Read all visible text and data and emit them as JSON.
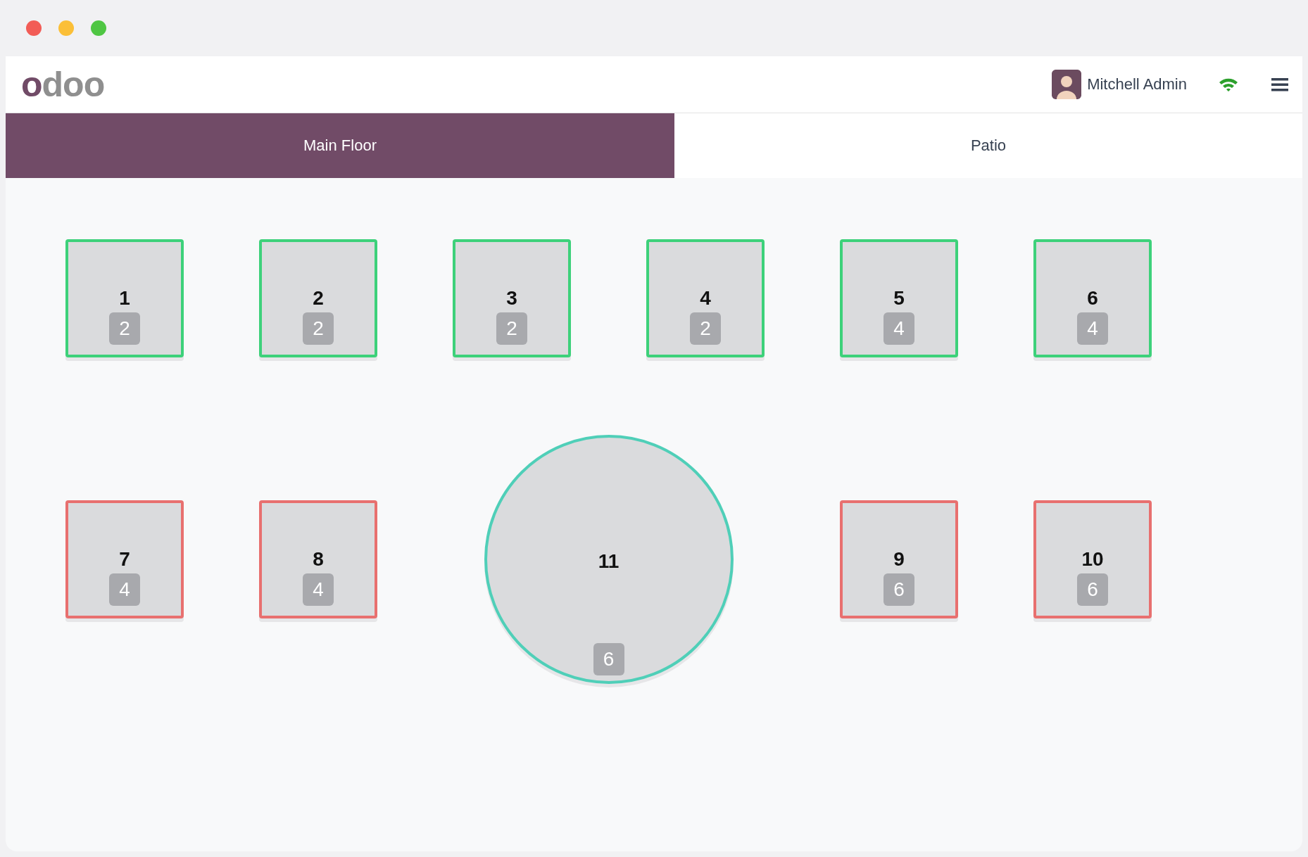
{
  "header": {
    "logo": "odoo",
    "user": "Mitchell Admin"
  },
  "tabs": [
    {
      "label": "Main Floor",
      "selected": true
    },
    {
      "label": "Patio",
      "selected": false
    }
  ],
  "tables": [
    {
      "kind": "square",
      "name": "1",
      "seats": "2",
      "color": "#3dd17a"
    },
    {
      "kind": "square",
      "name": "2",
      "seats": "2",
      "color": "#3dd17a"
    },
    {
      "kind": "square",
      "name": "3",
      "seats": "2",
      "color": "#3dd17a"
    },
    {
      "kind": "square",
      "name": "4",
      "seats": "2",
      "color": "#3dd17a"
    },
    {
      "kind": "square",
      "name": "5",
      "seats": "4",
      "color": "#3dd17a"
    },
    {
      "kind": "square",
      "name": "6",
      "seats": "4",
      "color": "#3dd17a"
    },
    {
      "kind": "square",
      "name": "7",
      "seats": "4",
      "color": "#e8706f"
    },
    {
      "kind": "square",
      "name": "8",
      "seats": "4",
      "color": "#e8706f"
    },
    {
      "kind": "round",
      "name": "11",
      "seats": "6",
      "color": "#4fcfb8"
    },
    {
      "kind": "square",
      "name": "9",
      "seats": "6",
      "color": "#e8706f"
    },
    {
      "kind": "square",
      "name": "10",
      "seats": "6",
      "color": "#e8706f"
    }
  ]
}
